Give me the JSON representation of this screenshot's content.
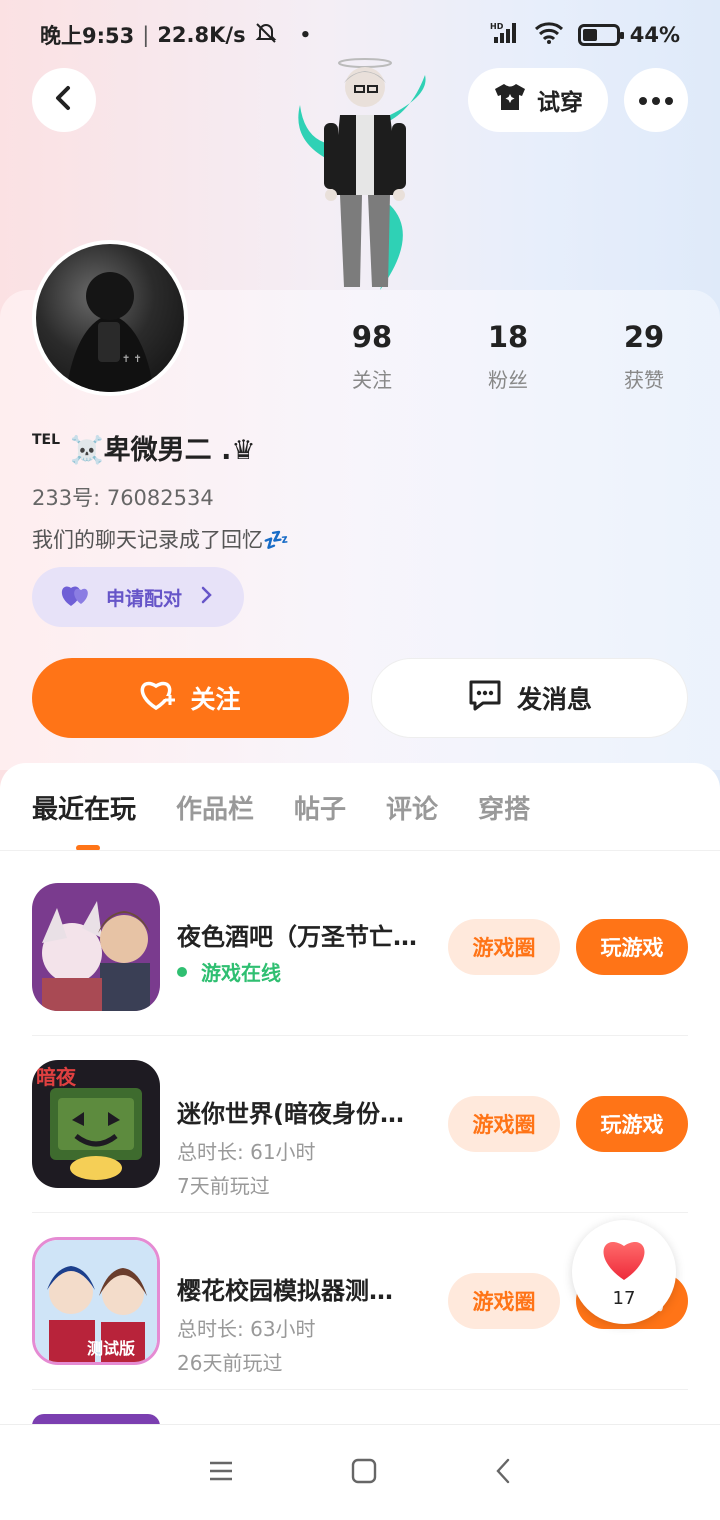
{
  "status_bar": {
    "time": "晚上9:53",
    "network_speed": "22.8K/s",
    "battery": "44%",
    "battery_level": 0.44
  },
  "header": {
    "try_on_label": "试穿"
  },
  "profile": {
    "stats": [
      {
        "value": "98",
        "label": "关注"
      },
      {
        "value": "18",
        "label": "粉丝"
      },
      {
        "value": "29",
        "label": "获赞"
      }
    ],
    "tel_badge": "TEL",
    "username": "☠️卑微男二 .♛",
    "uid": "233号: 76082534",
    "bio": "我们的聊天记录成了回忆💤",
    "match_label": "申请配对",
    "follow_label": "关注",
    "message_label": "发消息"
  },
  "tabs": [
    {
      "label": "最近在玩"
    },
    {
      "label": "作品栏"
    },
    {
      "label": "帖子"
    },
    {
      "label": "评论"
    },
    {
      "label": "穿搭"
    }
  ],
  "games": [
    {
      "title": "夜色酒吧（万圣节亡…",
      "status": "游戏在线",
      "circle_label": "游戏圈",
      "play_label": "玩游戏"
    },
    {
      "title": "迷你世界(暗夜身份…",
      "playtime": "总时长: 61小时",
      "last_played": "7天前玩过",
      "circle_label": "游戏圈",
      "play_label": "玩游戏"
    },
    {
      "title": "樱花校园模拟器测…",
      "playtime": "总时长: 63小时",
      "last_played": "26天前玩过",
      "circle_label": "游戏圈",
      "play_label": "玩游戏"
    }
  ],
  "like_float": {
    "count": "17"
  }
}
